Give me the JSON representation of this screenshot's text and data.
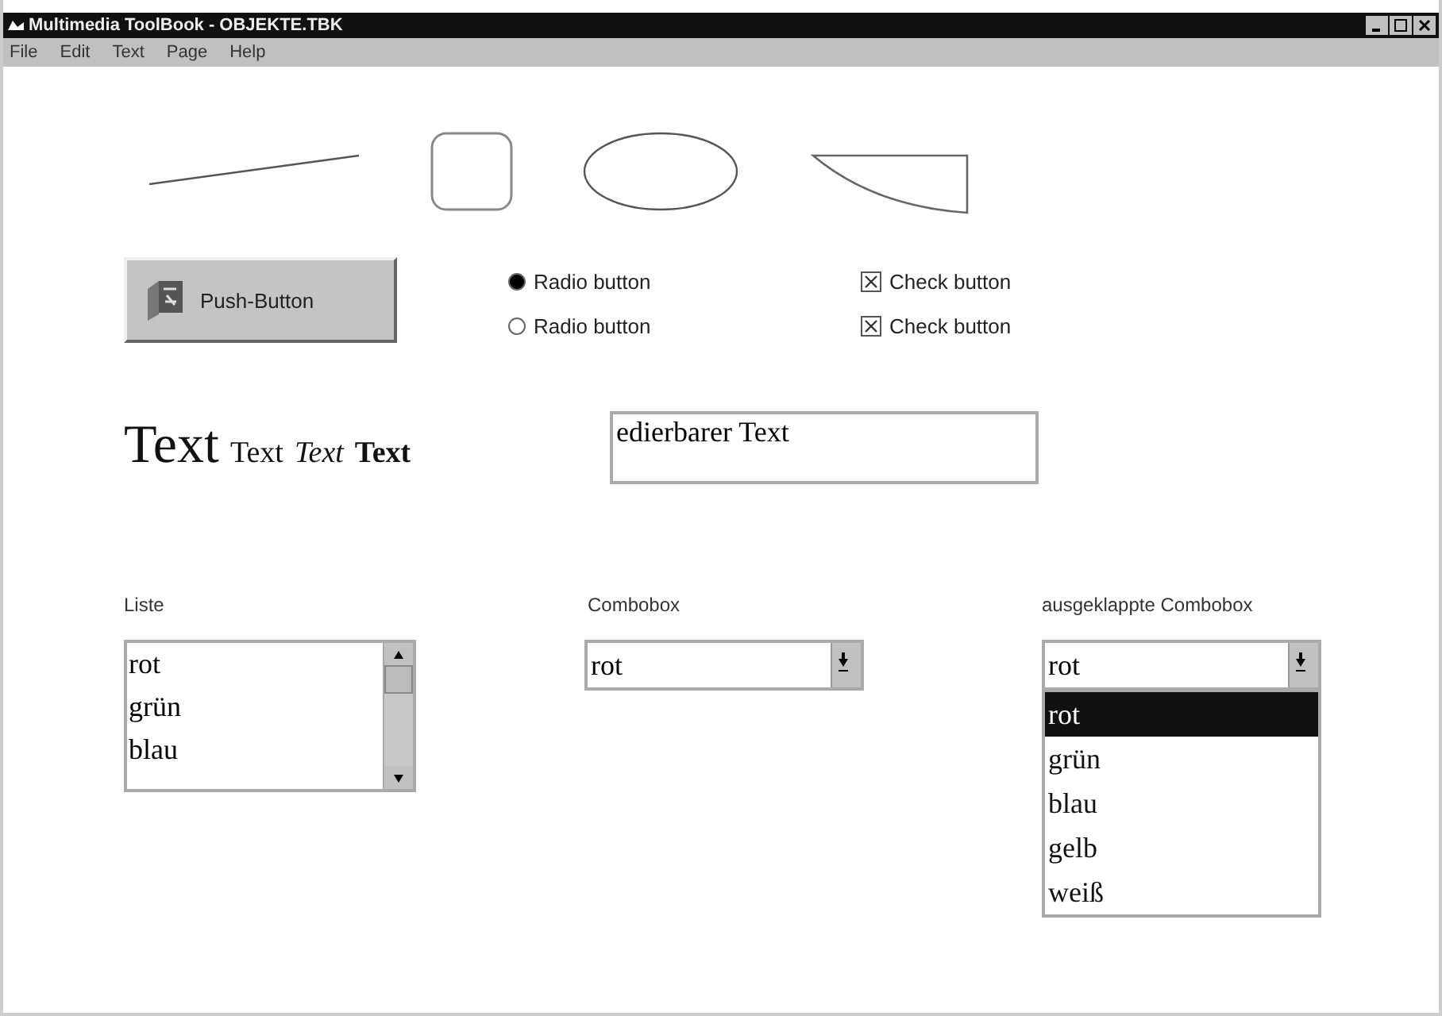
{
  "window": {
    "title": "Multimedia ToolBook - OBJEKTE.TBK"
  },
  "menu": [
    "File",
    "Edit",
    "Text",
    "Page",
    "Help"
  ],
  "push_button": {
    "label": "Push-Button"
  },
  "radios": [
    {
      "label": "Radio button",
      "selected": true
    },
    {
      "label": "Radio button",
      "selected": false
    }
  ],
  "checks": [
    {
      "label": "Check button",
      "checked": true
    },
    {
      "label": "Check button",
      "checked": true
    }
  ],
  "texts": [
    {
      "text": "Text",
      "kind": "large"
    },
    {
      "text": "Text",
      "kind": "plain"
    },
    {
      "text": "Text",
      "kind": "italic"
    },
    {
      "text": "Text",
      "kind": "bold"
    }
  ],
  "editable_field": {
    "value": "edierbarer Text"
  },
  "list": {
    "label": "Liste",
    "items": [
      "rot",
      "grün",
      "blau"
    ]
  },
  "combobox": {
    "label": "Combobox",
    "value": "rot"
  },
  "open_combobox": {
    "label": "ausgeklappte Combobox",
    "value": "rot",
    "items": [
      {
        "text": "rot",
        "selected": true
      },
      {
        "text": "grün",
        "selected": false
      },
      {
        "text": "blau",
        "selected": false
      },
      {
        "text": "gelb",
        "selected": false
      },
      {
        "text": "weiß",
        "selected": false
      }
    ]
  }
}
